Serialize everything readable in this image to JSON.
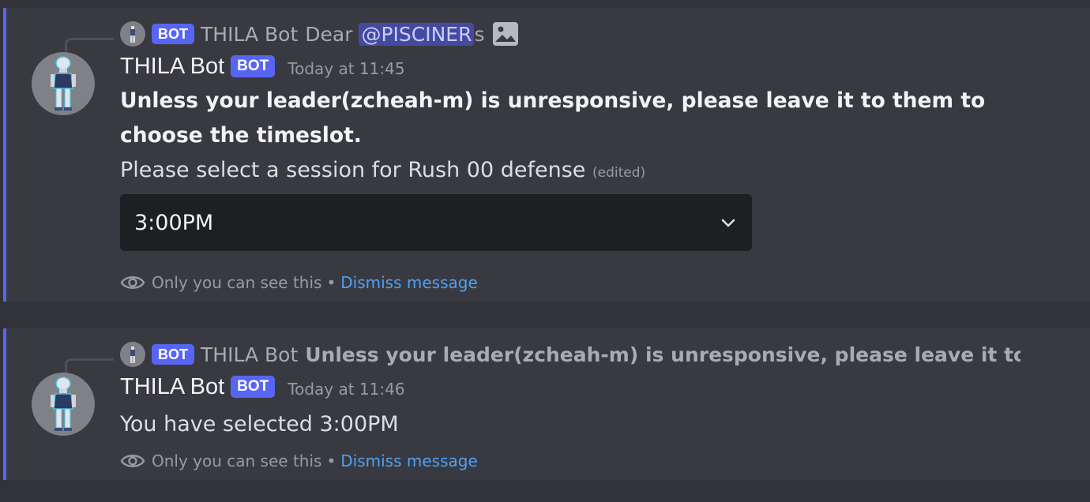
{
  "messages": [
    {
      "reply": {
        "author": "THILA Bot",
        "bot_tag": "BOT",
        "text_before": "Dear",
        "mention": "@PISCINER",
        "text_after": "s",
        "attachment_icon": "image-icon"
      },
      "author": "THILA Bot",
      "bot_tag": "BOT",
      "timestamp": "Today at 11:45",
      "bold_text": "Unless your leader(zcheah-m) is unresponsive, please leave it to them to choose the timeslot.",
      "text": "Please select a session for Rush 00 defense",
      "edited": "(edited)",
      "select": {
        "value": "3:00PM",
        "icon": "chevron-down-icon"
      },
      "ephemeral": {
        "note": "Only you can see this",
        "separator": "•",
        "dismiss": "Dismiss message"
      }
    },
    {
      "reply": {
        "author": "THILA Bot",
        "bot_tag": "BOT",
        "text": "Unless your leader(zcheah-m) is unresponsive, please leave it to them to c"
      },
      "author": "THILA Bot",
      "bot_tag": "BOT",
      "timestamp": "Today at 11:46",
      "text": "You have selected 3:00PM",
      "ephemeral": {
        "note": "Only you can see this",
        "separator": "•",
        "dismiss": "Dismiss message"
      }
    }
  ],
  "colors": {
    "background": "#313338",
    "message_highlight": "#393a41",
    "accent_bar": "#5865f2",
    "bot_tag": "#5865f2",
    "link": "#4ea0f5",
    "select_bg": "#1e1f22"
  }
}
